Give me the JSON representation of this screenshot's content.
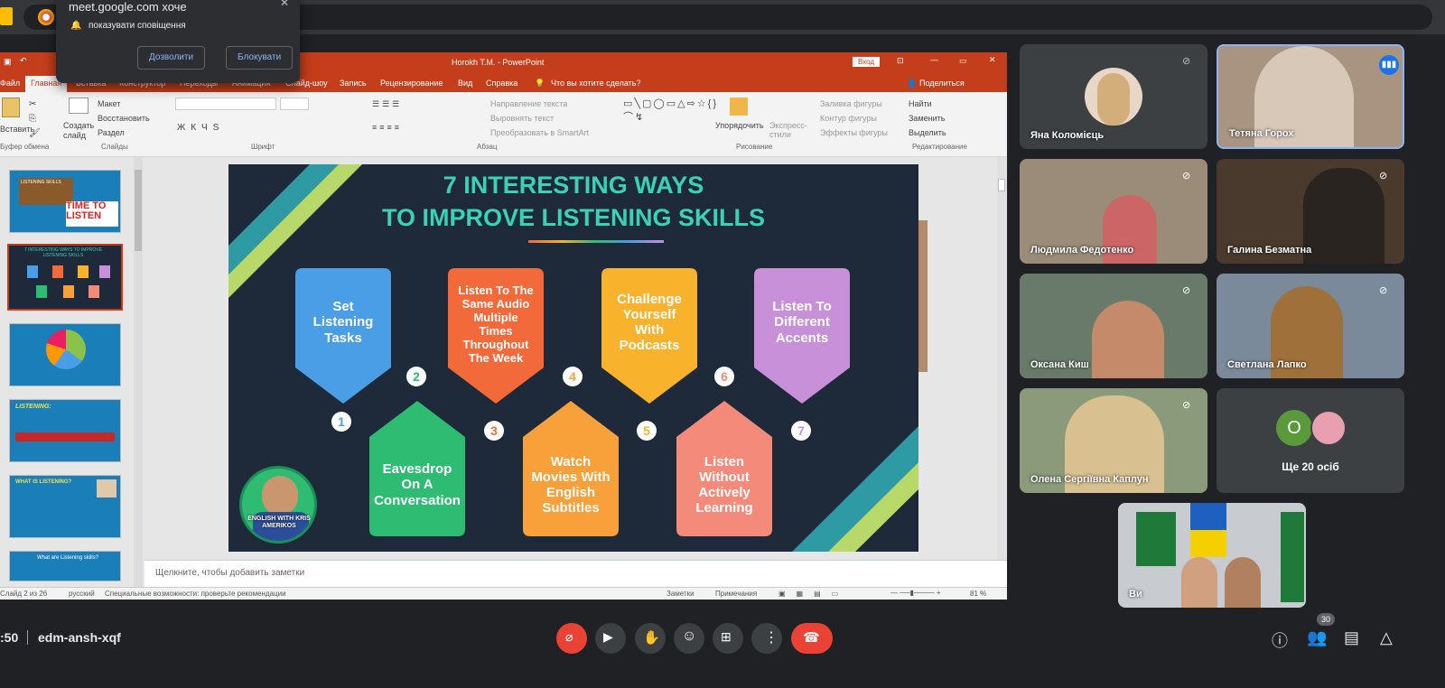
{
  "notification": {
    "origin": "meet.google.com хоче",
    "message": "показувати сповіщення",
    "allow_label": "Дозволити",
    "block_label": "Блокувати"
  },
  "ppt": {
    "title": "Horokh T.M.  -  PowerPoint",
    "login_label": "Вход",
    "tabs": [
      "Файл",
      "Главная",
      "Вставка",
      "Конструктор",
      "Переходы",
      "Анимация",
      "Слайд-шоу",
      "Запись",
      "Рецензирование",
      "Вид",
      "Справка"
    ],
    "tell_me": "Что вы хотите сделать?",
    "share": "Поделиться",
    "ribbon": {
      "paste": "Вставить",
      "clipboard": "Буфер обмена",
      "create_slide": "Создать слайд",
      "layout": "Макет",
      "restore": "Восстановить",
      "section": "Раздел",
      "slides_group": "Слайды",
      "font_group": "Шрифт",
      "text_dir": "Направление текста",
      "align_text": "Выровнять текст",
      "smartart": "Преобразовать в SmartArt",
      "paragraph_group": "Абзац",
      "arrange": "Упорядочить",
      "quick_styles": "Экспресс-стили",
      "fill": "Заливка фигуры",
      "outline": "Контур фигуры",
      "effects": "Эффекты фигуры",
      "drawing_group": "Рисование",
      "find": "Найти",
      "replace": "Заменить",
      "select": "Выделить",
      "editing_group": "Редактирование"
    },
    "notes_placeholder": "Щелкните, чтобы добавить заметки",
    "status": {
      "slide": "Слайд 2 из 26",
      "language": "русский",
      "accessibility": "Специальные возможности: проверьте рекомендации",
      "notes": "Заметки",
      "comments": "Примечания",
      "zoom": "81 %"
    }
  },
  "slide": {
    "title_line1": "7 INTERESTING WAYS",
    "title_line2": "TO IMPROVE LISTENING SKILLS",
    "cards": [
      {
        "n": "1",
        "text": "Set Listening Tasks"
      },
      {
        "n": "2",
        "text": "Eavesdrop On A Conversation"
      },
      {
        "n": "3",
        "text": "Listen To The Same Audio Multiple Times Throughout The Week"
      },
      {
        "n": "4",
        "text": "Watch Movies With English Subtitles"
      },
      {
        "n": "5",
        "text": "Challenge Yourself With Podcasts"
      },
      {
        "n": "6",
        "text": "Listen Without Actively Learning"
      },
      {
        "n": "7",
        "text": "Listen To Different Accents"
      }
    ],
    "logo_text": "ENGLISH WITH KRIS AMERIKOS"
  },
  "thumbs": {
    "t1_a": "LISTENING SKILLS",
    "t1_b": "TIME TO LISTEN",
    "t2": "7 INTERESTING WAYS TO IMPROVE LISTENING SKILLS",
    "t4_title": "LISTENING:",
    "t5_title": "WHAT IS LISTENING?",
    "t6_title": "What are Listening skills?"
  },
  "participants": [
    {
      "name": "Яна Коломієць"
    },
    {
      "name": "Тетяна Горох"
    },
    {
      "name": "Людмила Федотенко"
    },
    {
      "name": "Галина Безматна"
    },
    {
      "name": "Оксана Киш"
    },
    {
      "name": "Светлана Лапко"
    },
    {
      "name": "Олена Сергіївна Каплун"
    },
    {
      "name": "Ще 20 осіб",
      "initial": "О"
    },
    {
      "name": "Ви"
    }
  ],
  "meeting": {
    "time": ":50",
    "code": "edm-ansh-xqf",
    "people_count": "30"
  },
  "colors": {
    "end_call": "#ea4335",
    "mic_off": "#ea4335",
    "ppt_orange": "#c43e1c"
  }
}
